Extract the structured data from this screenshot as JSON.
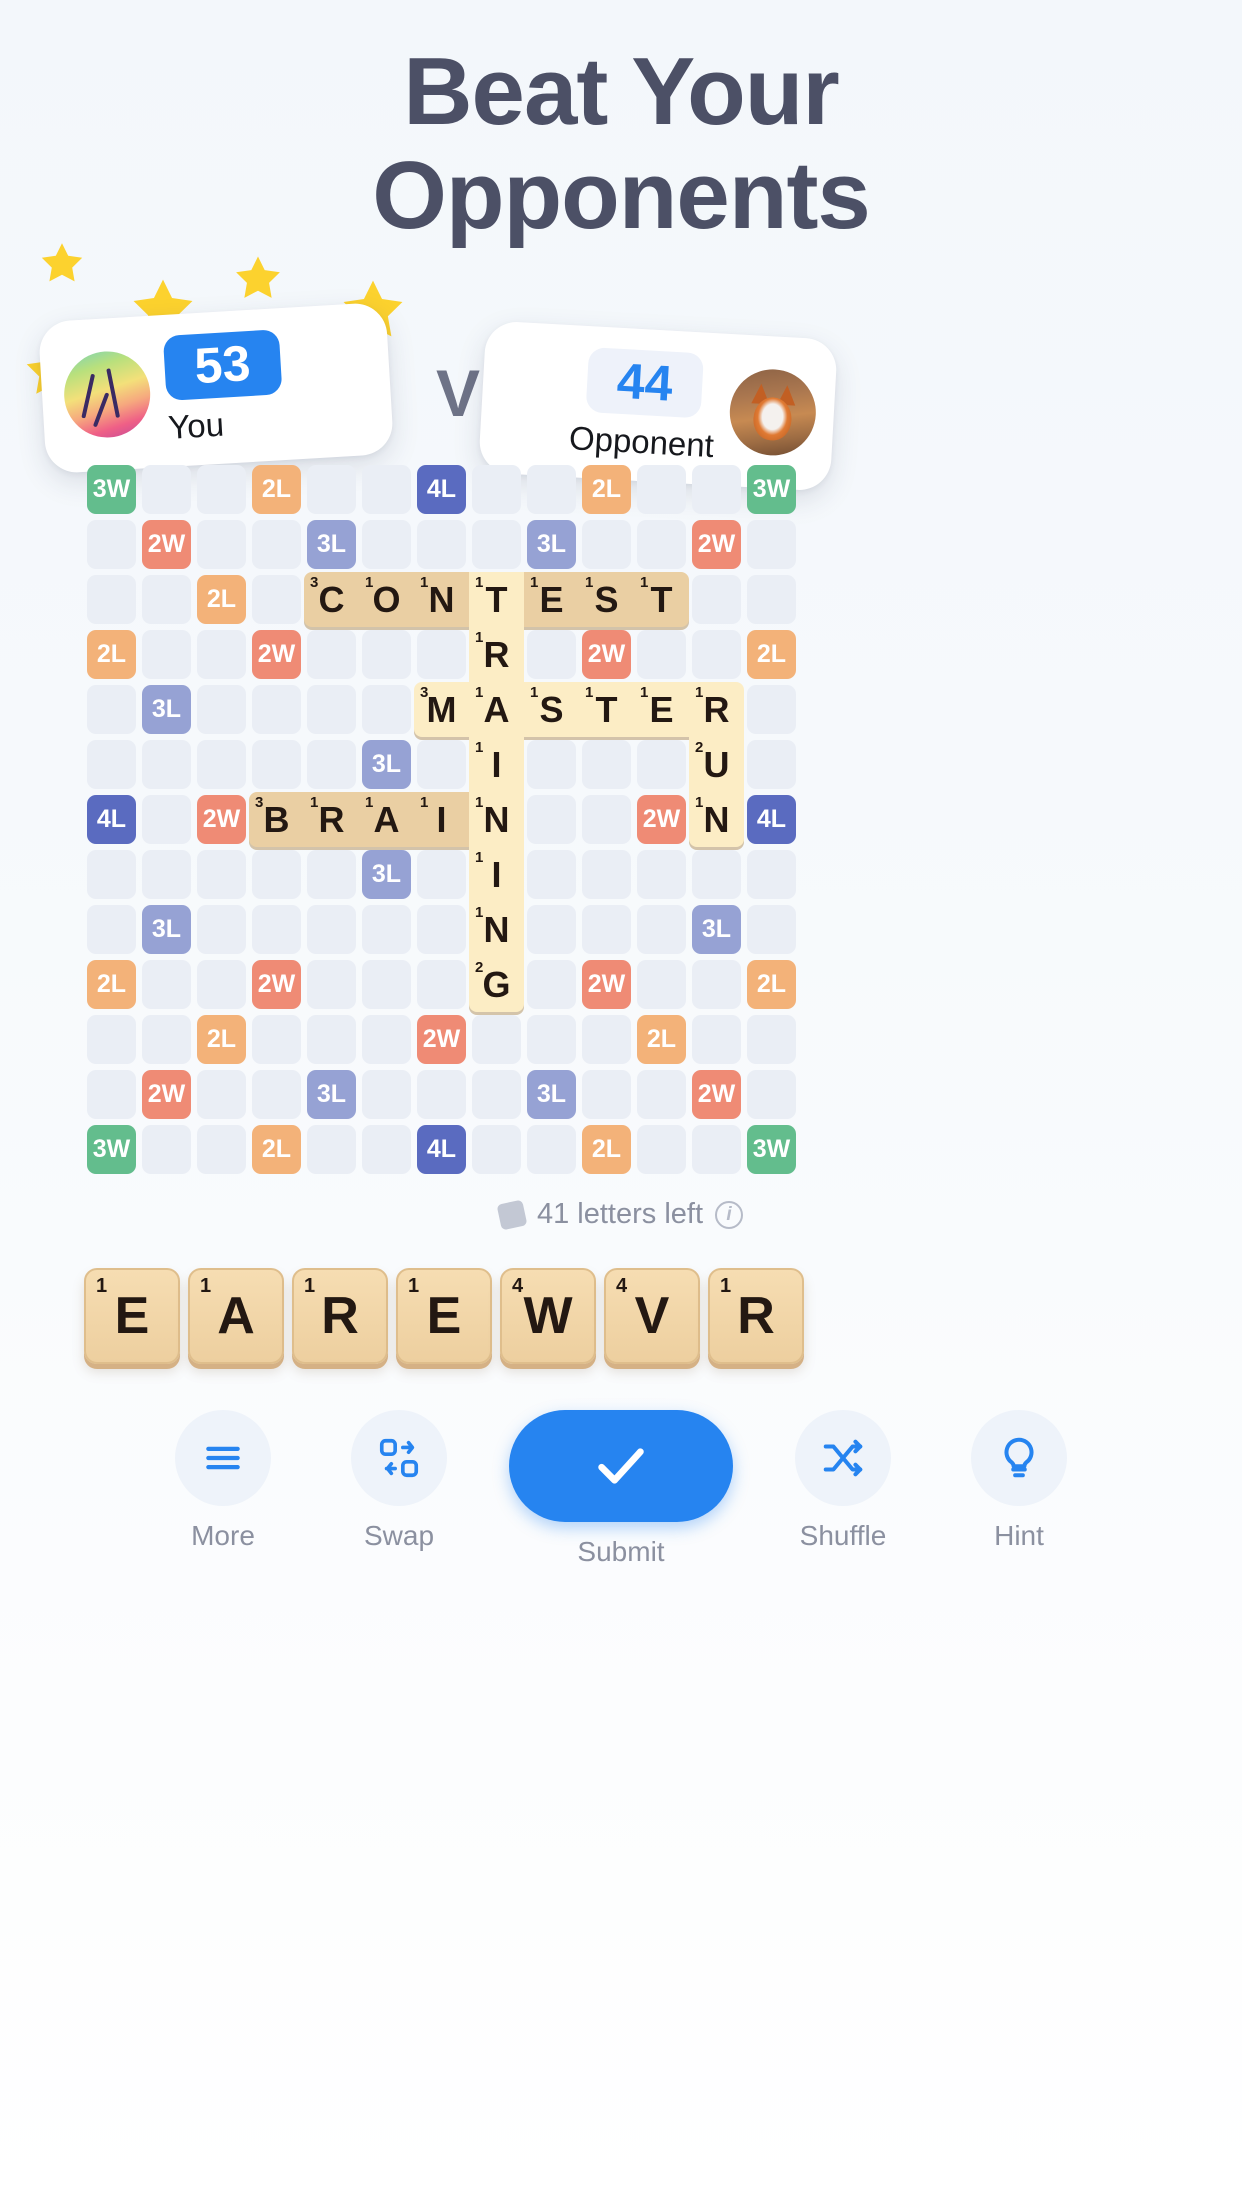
{
  "headline": {
    "line1": "Beat Your",
    "line2": "Opponents"
  },
  "vs_label": "VS",
  "players": {
    "you": {
      "name": "You",
      "score": "53",
      "avatar_icon": "beach-palm-avatar",
      "score_color": "#2684f0"
    },
    "opponent": {
      "name": "Opponent",
      "score": "44",
      "avatar_icon": "fox-avatar",
      "score_color": "#2684f0"
    }
  },
  "board": {
    "cols": 13,
    "rows": 13,
    "bonus_legend": {
      "3W": "Triple Word",
      "2W": "Double Word",
      "3L": "Triple Letter",
      "2L": "Double Letter",
      "4L": "Quadruple Letter"
    },
    "bonus_colors": {
      "3W": "#63bd8d",
      "2W": "#ef8b75",
      "3L": "#96a2d4",
      "2L": "#f3b279",
      "4L": "#5a6bc0",
      "empty": "#eaeef5"
    },
    "bonuses": [
      {
        "r": 0,
        "c": 0,
        "label": "3W"
      },
      {
        "r": 0,
        "c": 3,
        "label": "2L"
      },
      {
        "r": 0,
        "c": 6,
        "label": "4L"
      },
      {
        "r": 0,
        "c": 9,
        "label": "2L"
      },
      {
        "r": 0,
        "c": 12,
        "label": "3W"
      },
      {
        "r": 1,
        "c": 1,
        "label": "2W"
      },
      {
        "r": 1,
        "c": 4,
        "label": "3L"
      },
      {
        "r": 1,
        "c": 8,
        "label": "3L"
      },
      {
        "r": 1,
        "c": 11,
        "label": "2W"
      },
      {
        "r": 2,
        "c": 2,
        "label": "2L"
      },
      {
        "r": 3,
        "c": 0,
        "label": "2L"
      },
      {
        "r": 3,
        "c": 3,
        "label": "2W"
      },
      {
        "r": 3,
        "c": 9,
        "label": "2W"
      },
      {
        "r": 3,
        "c": 12,
        "label": "2L"
      },
      {
        "r": 4,
        "c": 1,
        "label": "3L"
      },
      {
        "r": 5,
        "c": 5,
        "label": "3L"
      },
      {
        "r": 6,
        "c": 0,
        "label": "4L"
      },
      {
        "r": 6,
        "c": 2,
        "label": "2W"
      },
      {
        "r": 6,
        "c": 10,
        "label": "2W"
      },
      {
        "r": 6,
        "c": 12,
        "label": "4L"
      },
      {
        "r": 7,
        "c": 5,
        "label": "3L"
      },
      {
        "r": 8,
        "c": 1,
        "label": "3L"
      },
      {
        "r": 8,
        "c": 11,
        "label": "3L"
      },
      {
        "r": 9,
        "c": 0,
        "label": "2L"
      },
      {
        "r": 9,
        "c": 3,
        "label": "2W"
      },
      {
        "r": 9,
        "c": 9,
        "label": "2W"
      },
      {
        "r": 9,
        "c": 12,
        "label": "2L"
      },
      {
        "r": 10,
        "c": 2,
        "label": "2L"
      },
      {
        "r": 10,
        "c": 6,
        "label": "2W"
      },
      {
        "r": 10,
        "c": 10,
        "label": "2L"
      },
      {
        "r": 11,
        "c": 1,
        "label": "2W"
      },
      {
        "r": 11,
        "c": 4,
        "label": "3L"
      },
      {
        "r": 11,
        "c": 8,
        "label": "3L"
      },
      {
        "r": 11,
        "c": 11,
        "label": "2W"
      },
      {
        "r": 12,
        "c": 0,
        "label": "3W"
      },
      {
        "r": 12,
        "c": 3,
        "label": "2L"
      },
      {
        "r": 12,
        "c": 6,
        "label": "4L"
      },
      {
        "r": 12,
        "c": 9,
        "label": "2L"
      },
      {
        "r": 12,
        "c": 12,
        "label": "3W"
      }
    ],
    "tiles": [
      {
        "r": 2,
        "c": 4,
        "letter": "C",
        "points": "3",
        "state": "placed"
      },
      {
        "r": 2,
        "c": 5,
        "letter": "O",
        "points": "1",
        "state": "placed"
      },
      {
        "r": 2,
        "c": 6,
        "letter": "N",
        "points": "1",
        "state": "placed"
      },
      {
        "r": 2,
        "c": 7,
        "letter": "T",
        "points": "1",
        "state": "new"
      },
      {
        "r": 2,
        "c": 8,
        "letter": "E",
        "points": "1",
        "state": "placed"
      },
      {
        "r": 2,
        "c": 9,
        "letter": "S",
        "points": "1",
        "state": "placed"
      },
      {
        "r": 2,
        "c": 10,
        "letter": "T",
        "points": "1",
        "state": "placed"
      },
      {
        "r": 3,
        "c": 7,
        "letter": "R",
        "points": "1",
        "state": "new"
      },
      {
        "r": 4,
        "c": 6,
        "letter": "M",
        "points": "3",
        "state": "new"
      },
      {
        "r": 4,
        "c": 7,
        "letter": "A",
        "points": "1",
        "state": "new"
      },
      {
        "r": 4,
        "c": 8,
        "letter": "S",
        "points": "1",
        "state": "new"
      },
      {
        "r": 4,
        "c": 9,
        "letter": "T",
        "points": "1",
        "state": "new"
      },
      {
        "r": 4,
        "c": 10,
        "letter": "E",
        "points": "1",
        "state": "new"
      },
      {
        "r": 4,
        "c": 11,
        "letter": "R",
        "points": "1",
        "state": "new"
      },
      {
        "r": 5,
        "c": 7,
        "letter": "I",
        "points": "1",
        "state": "new"
      },
      {
        "r": 5,
        "c": 11,
        "letter": "U",
        "points": "2",
        "state": "new"
      },
      {
        "r": 6,
        "c": 3,
        "letter": "B",
        "points": "3",
        "state": "placed"
      },
      {
        "r": 6,
        "c": 4,
        "letter": "R",
        "points": "1",
        "state": "placed"
      },
      {
        "r": 6,
        "c": 5,
        "letter": "A",
        "points": "1",
        "state": "placed"
      },
      {
        "r": 6,
        "c": 6,
        "letter": "I",
        "points": "1",
        "state": "placed"
      },
      {
        "r": 6,
        "c": 7,
        "letter": "N",
        "points": "1",
        "state": "new"
      },
      {
        "r": 6,
        "c": 11,
        "letter": "N",
        "points": "1",
        "state": "new"
      },
      {
        "r": 7,
        "c": 7,
        "letter": "I",
        "points": "1",
        "state": "new"
      },
      {
        "r": 8,
        "c": 7,
        "letter": "N",
        "points": "1",
        "state": "new"
      },
      {
        "r": 9,
        "c": 7,
        "letter": "G",
        "points": "2",
        "state": "new"
      }
    ],
    "words_on_board": [
      "CONTEST",
      "TRAINING",
      "MASTER",
      "BRAIN",
      "RUN"
    ]
  },
  "letters_left": {
    "text": "41 letters left",
    "bag_icon": "tile-bag-icon",
    "info_icon": "info-icon"
  },
  "rack": [
    {
      "letter": "E",
      "points": "1"
    },
    {
      "letter": "A",
      "points": "1"
    },
    {
      "letter": "R",
      "points": "1"
    },
    {
      "letter": "E",
      "points": "1"
    },
    {
      "letter": "W",
      "points": "4"
    },
    {
      "letter": "V",
      "points": "4"
    },
    {
      "letter": "R",
      "points": "1"
    }
  ],
  "toolbar": [
    {
      "label": "More",
      "icon": "hamburger-menu-icon"
    },
    {
      "label": "Swap",
      "icon": "swap-tiles-icon"
    },
    {
      "label": "Submit",
      "icon": "checkmark-icon"
    },
    {
      "label": "Shuffle",
      "icon": "shuffle-icon"
    },
    {
      "label": "Hint",
      "icon": "lightbulb-icon"
    }
  ]
}
